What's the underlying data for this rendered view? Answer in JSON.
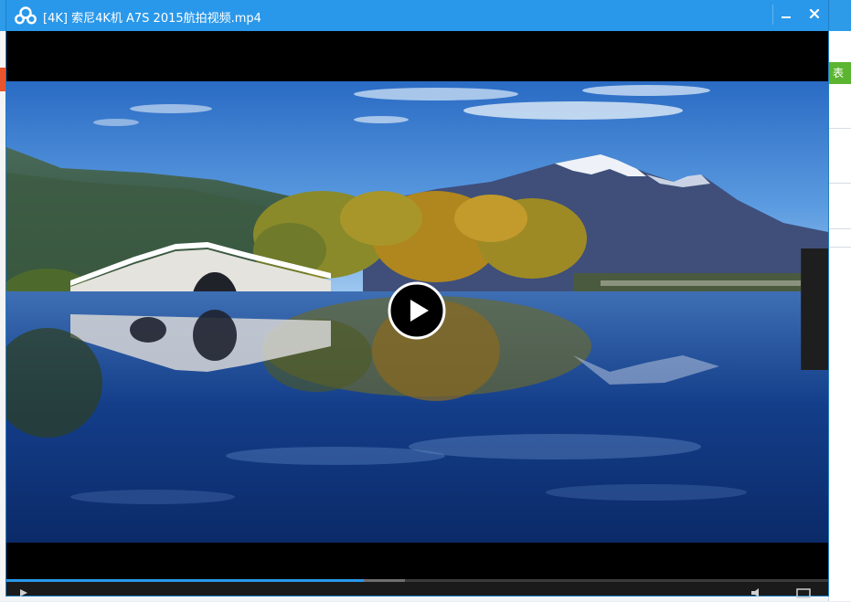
{
  "window": {
    "title": "[4K] 索尼4K机 A7S 2015航拍视频.mp4"
  },
  "background_app": {
    "right_tab_label": "表"
  },
  "player": {
    "progress_fraction": 0.435,
    "buffered_fraction": 0.485,
    "accent_color": "#2a98ea"
  },
  "icons": {
    "logo": "cloud-logo-icon",
    "minimize": "minimize-icon",
    "close": "close-icon",
    "play": "play-icon"
  }
}
